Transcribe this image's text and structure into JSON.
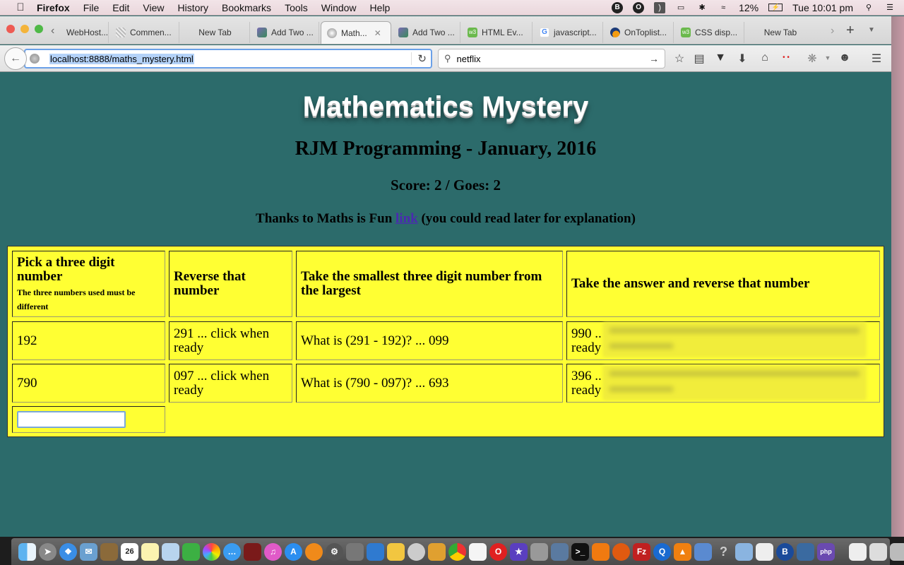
{
  "menubar": {
    "apple_icon": "apple-icon",
    "items": [
      "Firefox",
      "File",
      "Edit",
      "View",
      "History",
      "Bookmarks",
      "Tools",
      "Window",
      "Help"
    ],
    "status": {
      "battery": "12%",
      "clock": "Tue 10:01 pm",
      "icons": [
        "b-circle-icon",
        "o-circle-icon",
        "audio-icon",
        "airplay-icon",
        "bluetooth-icon",
        "wifi-icon",
        "battery-charging-icon",
        "spotlight-search-icon",
        "notification-list-icon"
      ]
    }
  },
  "browser": {
    "tabs": [
      {
        "label": "WebHost...",
        "icon": "none",
        "active": false
      },
      {
        "label": "Commen...",
        "icon": "comment-icon",
        "active": false
      },
      {
        "label": "New Tab",
        "icon": "none",
        "active": false
      },
      {
        "label": "Add Two ...",
        "icon": "doc-icon",
        "active": false
      },
      {
        "label": "Math...",
        "icon": "globe-icon",
        "active": true
      },
      {
        "label": "Add Two ...",
        "icon": "doc-icon",
        "active": false
      },
      {
        "label": "HTML Ev...",
        "icon": "w3schools-icon",
        "active": false
      },
      {
        "label": "javascript...",
        "icon": "google-icon",
        "active": false
      },
      {
        "label": "OnToplist...",
        "icon": "ontoplist-icon",
        "active": false
      },
      {
        "label": "CSS disp...",
        "icon": "w3schools-icon",
        "active": false
      },
      {
        "label": "New Tab",
        "icon": "none",
        "active": false
      }
    ],
    "url": "localhost:8888/maths_mystery.html",
    "search_value": "netflix",
    "w3_glyph": "w3",
    "google_glyph": "G"
  },
  "page": {
    "title": "Mathematics Mystery",
    "subtitle": "RJM Programming - January, 2016",
    "score": "Score: 2 / Goes: 2",
    "credit_prefix": "Thanks to Maths is Fun ",
    "credit_link": "link",
    "credit_suffix": " (you could read later for explanation)",
    "table": {
      "headers": [
        {
          "title": "Pick a three digit number",
          "note": "The three numbers used must be different"
        },
        {
          "title": "Reverse that number"
        },
        {
          "title": "Take the smallest three digit number from the largest"
        },
        {
          "title": "Take the answer and reverse that number"
        }
      ],
      "rows": [
        {
          "pick": "192",
          "reverse": "291 ... click when ready",
          "subtract": "What is (291 - 192)? ... 099",
          "answer_reverse_visible": "990 ..",
          "answer_reverse_line2": "ready"
        },
        {
          "pick": "790",
          "reverse": "097 ... click when ready",
          "subtract": "What is (790 - 097)? ... 693",
          "answer_reverse_visible": "396 ..",
          "answer_reverse_line2": "ready"
        }
      ],
      "input_value": ""
    }
  },
  "dock": {
    "calendar_day": "26",
    "apps": [
      "finder",
      "launchpad",
      "safari",
      "mail",
      "notefile",
      "calendar",
      "notes",
      "preview",
      "facetime",
      "photos",
      "messages",
      "photo-booth",
      "itunes",
      "app-store",
      "ibooks",
      "system-preferences",
      "gimp",
      "xcode",
      "wireshark",
      "console-app",
      "image-tool",
      "chrome",
      "textedit",
      "opera",
      "imovie",
      "migration-assistant",
      "image-capture",
      "terminal",
      "avast",
      "firefox",
      "filezilla",
      "quicktime",
      "vlc",
      "remote-desktop",
      "help",
      "virtualbox-box",
      "script-editor",
      "bbedit",
      "virtualbox",
      "php-storm",
      "document",
      "mail-attachment",
      "trash"
    ]
  }
}
